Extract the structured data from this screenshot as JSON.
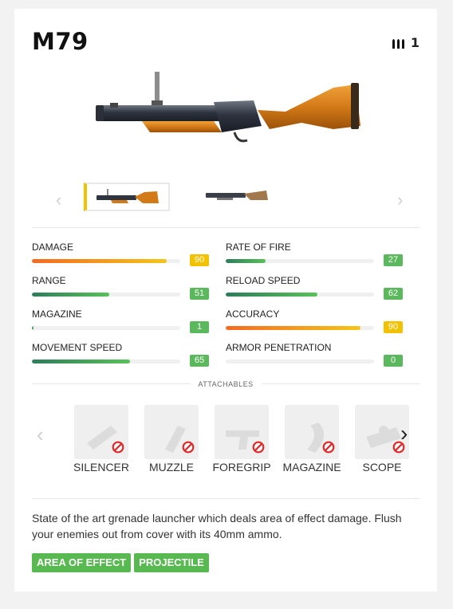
{
  "weapon": {
    "name": "M79",
    "ammo_count": "1"
  },
  "stats": [
    {
      "label": "DAMAGE",
      "value": "90",
      "fill": 0.91,
      "style": "orange"
    },
    {
      "label": "RATE OF FIRE",
      "value": "27",
      "fill": 0.27,
      "style": "green"
    },
    {
      "label": "RANGE",
      "value": "51",
      "fill": 0.52,
      "style": "green"
    },
    {
      "label": "RELOAD SPEED",
      "value": "62",
      "fill": 0.62,
      "style": "green"
    },
    {
      "label": "MAGAZINE",
      "value": "1",
      "fill": 0.01,
      "style": "green"
    },
    {
      "label": "ACCURACY",
      "value": "90",
      "fill": 0.91,
      "style": "orange"
    },
    {
      "label": "MOVEMENT SPEED",
      "value": "65",
      "fill": 0.66,
      "style": "green"
    },
    {
      "label": "ARMOR PENETRATION",
      "value": "0",
      "fill": 0,
      "style": "green"
    }
  ],
  "attachables": {
    "title": "ATTACHABLES",
    "items": [
      {
        "label": "SILENCER",
        "icon": "silencer-icon"
      },
      {
        "label": "MUZZLE",
        "icon": "muzzle-icon"
      },
      {
        "label": "FOREGRIP",
        "icon": "foregrip-icon"
      },
      {
        "label": "MAGAZINE",
        "icon": "magazine-icon"
      },
      {
        "label": "SCOPE",
        "icon": "scope-icon"
      }
    ]
  },
  "description": "State of the art grenade launcher which deals area of effect damage. Flush your enemies out from cover with its 40mm ammo.",
  "tags": [
    "AREA OF EFFECT",
    "PROJECTILE"
  ],
  "colors": {
    "tag_green": "#57b94f",
    "badge_green": "#5cb85c",
    "badge_yellow": "#f2c200",
    "accent_yellow": "#f2c200"
  }
}
